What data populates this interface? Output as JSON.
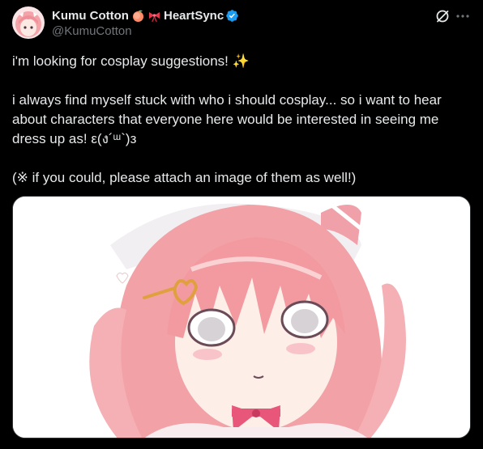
{
  "author": {
    "display_name": "Kumu Cotton",
    "affiliate_name": "HeartSync",
    "handle": "@KumuCotton",
    "name_emojis": [
      "peach-icon",
      "ribbon-bow-icon"
    ],
    "verified": true,
    "verified_color": "#1d9bf0"
  },
  "header_actions": {
    "grok_icon": "grok-icon",
    "more_icon": "more-icon"
  },
  "tweet": {
    "line1": "i'm looking for cosplay suggestions! ✨",
    "line2": "i always find myself stuck with who i should cosplay... so i want to hear about characters that everyone here would be interested in seeing me dress up as! ε(ง´ᵚ`)з",
    "line3": "(※ if you could, please attach an image of them as well!)"
  },
  "media": {
    "type": "illustration",
    "subject": "anime girl with pink hair, heart hair clip and pink ribbon"
  },
  "colors": {
    "background": "#000000",
    "text": "#e7e9ea",
    "secondary_text": "#71767b",
    "hair_pink": "#f4a3a8",
    "accent_pink": "#e8567a"
  }
}
